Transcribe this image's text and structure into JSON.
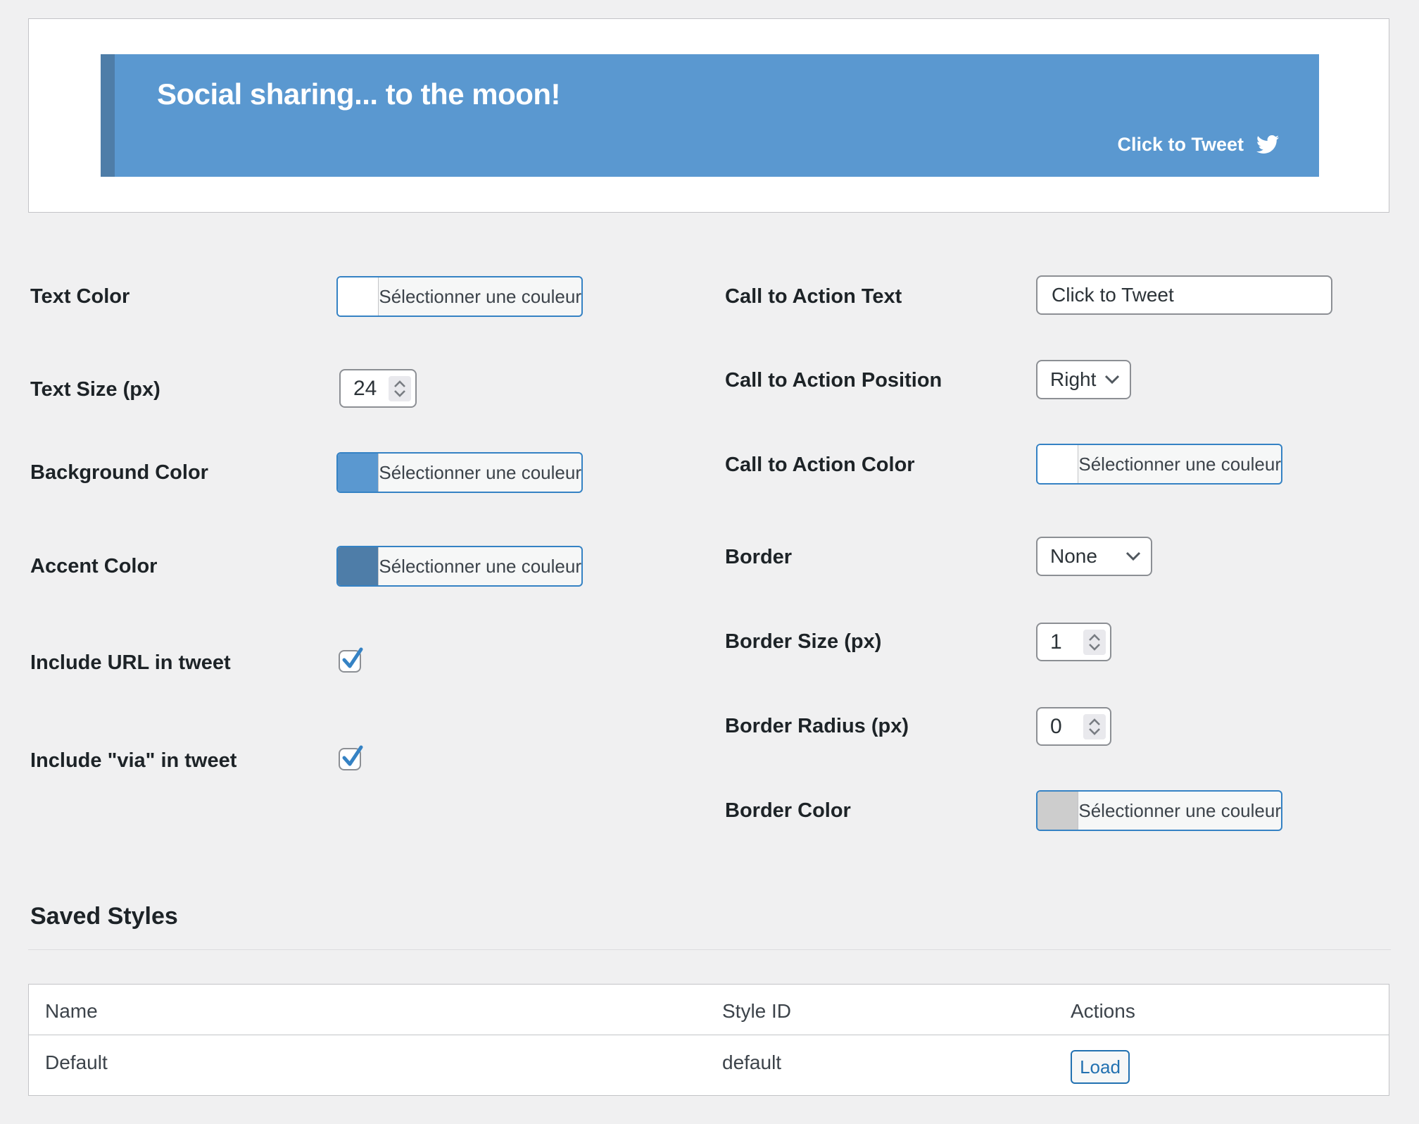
{
  "page": {
    "background": "#f0f0f1"
  },
  "preview": {
    "quote_text": "Social sharing... to the moon!",
    "cta_label": "Click to Tweet",
    "banner_color": "#5a98d0",
    "accent_color": "#4e7da8"
  },
  "fields": {
    "text_color": {
      "label": "Text Color",
      "button_label": "Sélectionner une couleur",
      "swatch": "#ffffff"
    },
    "text_size": {
      "label": "Text Size (px)",
      "value": "24"
    },
    "background_color": {
      "label": "Background Color",
      "button_label": "Sélectionner une couleur",
      "swatch": "#5a98d0"
    },
    "accent_color": {
      "label": "Accent Color",
      "button_label": "Sélectionner une couleur",
      "swatch": "#4e7da8"
    },
    "include_url": {
      "label": "Include URL in tweet",
      "checked": "true"
    },
    "include_via": {
      "label": "Include \"via\" in tweet",
      "checked": "true"
    },
    "cta_text": {
      "label": "Call to Action Text",
      "value": "Click to Tweet"
    },
    "cta_position": {
      "label": "Call to Action Position",
      "value": "Right"
    },
    "cta_color": {
      "label": "Call to Action Color",
      "button_label": "Sélectionner une couleur",
      "swatch": "#ffffff"
    },
    "border": {
      "label": "Border",
      "value": "None"
    },
    "border_size": {
      "label": "Border Size (px)",
      "value": "1"
    },
    "border_radius": {
      "label": "Border Radius (px)",
      "value": "0"
    },
    "border_color": {
      "label": "Border Color",
      "button_label": "Sélectionner une couleur",
      "swatch": "#cdcdcd"
    }
  },
  "saved_styles": {
    "heading": "Saved Styles",
    "table": {
      "columns": [
        "Name",
        "Style ID",
        "Actions"
      ],
      "rows": [
        {
          "name": "Default",
          "style_id": "default",
          "action_label": "Load"
        }
      ]
    }
  }
}
